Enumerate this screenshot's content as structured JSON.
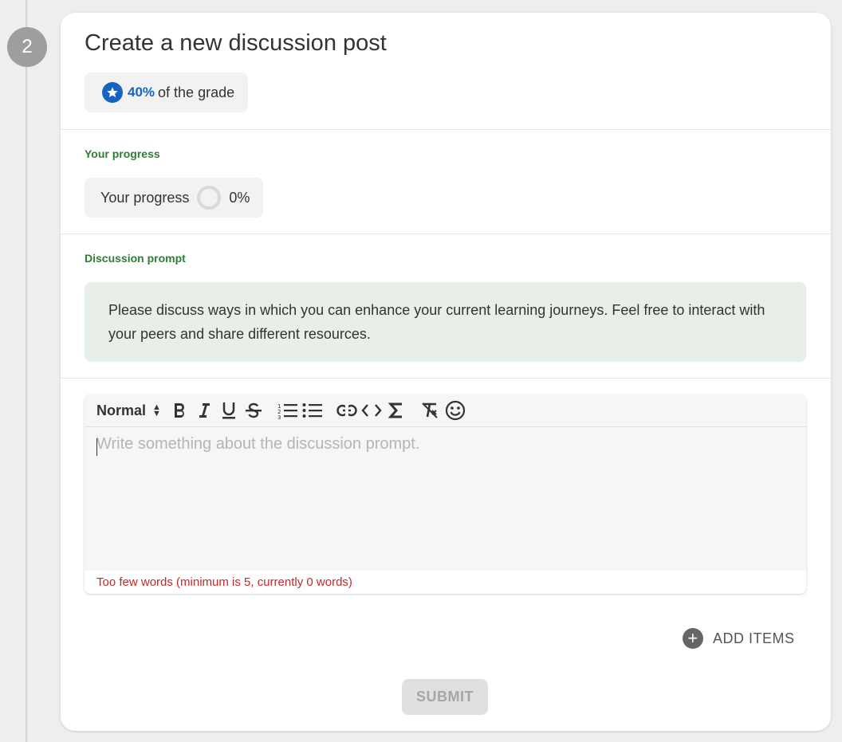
{
  "step": {
    "number": "2"
  },
  "card": {
    "title": "Create a new discussion post",
    "grade": {
      "percent": "40%",
      "suffix": "of the grade"
    }
  },
  "progress": {
    "section_label": "Your progress",
    "chip_label": "Your progress",
    "value": "0%"
  },
  "prompt": {
    "section_label": "Discussion prompt",
    "text": "Please discuss ways in which you can enhance your current learning journeys. Feel free to interact with your peers and share different resources."
  },
  "editor": {
    "format_select": "Normal",
    "placeholder": "Write something about the discussion prompt.",
    "error": "Too few words (minimum is 5, currently 0 words)",
    "toolbar_icons": [
      "bold-icon",
      "italic-icon",
      "underline-icon",
      "strikethrough-icon",
      "ordered-list-icon",
      "bullet-list-icon",
      "link-icon",
      "code-icon",
      "sigma-icon",
      "clear-format-icon",
      "emoji-icon"
    ]
  },
  "actions": {
    "add_items": "ADD ITEMS",
    "submit": "SUBMIT"
  },
  "colors": {
    "accent_blue": "#1565c0",
    "section_green": "#2e7d32",
    "error_red": "#c62828",
    "prompt_bg": "#e8efe8"
  }
}
